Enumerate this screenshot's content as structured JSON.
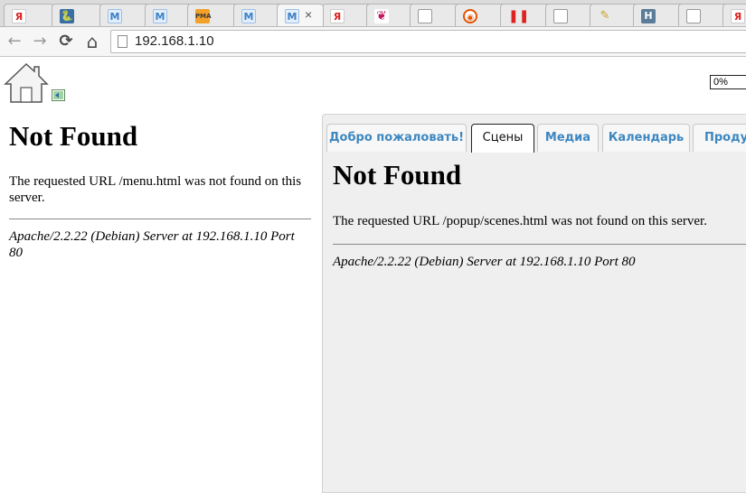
{
  "browser": {
    "tabs": [
      {
        "icon": "yandex-icon",
        "glyph": "Я"
      },
      {
        "icon": "python-icon",
        "glyph": "🐍"
      },
      {
        "icon": "m-icon",
        "glyph": "M"
      },
      {
        "icon": "m-icon",
        "glyph": "M"
      },
      {
        "icon": "phpmyadmin-icon",
        "glyph": "PMA"
      },
      {
        "icon": "m-icon",
        "glyph": "M"
      },
      {
        "icon": "m-icon",
        "glyph": "M",
        "active": true,
        "close": "×"
      },
      {
        "icon": "yandex-icon",
        "glyph": "Я"
      },
      {
        "icon": "raspberry-icon",
        "glyph": "❦"
      },
      {
        "icon": "document-icon",
        "glyph": ""
      },
      {
        "icon": "orange-circle-icon",
        "glyph": "◉"
      },
      {
        "icon": "pause-icon",
        "glyph": "❚❚"
      },
      {
        "icon": "document-icon",
        "glyph": ""
      },
      {
        "icon": "pen-icon",
        "glyph": "✎"
      },
      {
        "icon": "h-icon",
        "glyph": "H"
      },
      {
        "icon": "document-icon",
        "glyph": ""
      },
      {
        "icon": "yandex-icon",
        "glyph": "Я"
      }
    ],
    "nav": {
      "back": "←",
      "forward": "→",
      "reload": "⟳",
      "home": "⌂"
    },
    "url": "192.168.1.10"
  },
  "page": {
    "progress": "0%",
    "left": {
      "title": "Not Found",
      "message": "The requested URL /menu.html was not found on this server.",
      "address": "Apache/2.2.22 (Debian) Server at 192.168.1.10 Port 80"
    },
    "tabs": [
      {
        "label": "Добро пожаловать!"
      },
      {
        "label": "Сцены",
        "active": true
      },
      {
        "label": "Медиа"
      },
      {
        "label": "Календарь"
      },
      {
        "label": "Продукты"
      }
    ],
    "content": {
      "title": "Not Found",
      "message": "The requested URL /popup/scenes.html was not found on this server.",
      "address": "Apache/2.2.22 (Debian) Server at 192.168.1.10 Port 80"
    }
  },
  "colors": {
    "tab_link": "#3d87c0",
    "pane_bg": "#efefef"
  }
}
